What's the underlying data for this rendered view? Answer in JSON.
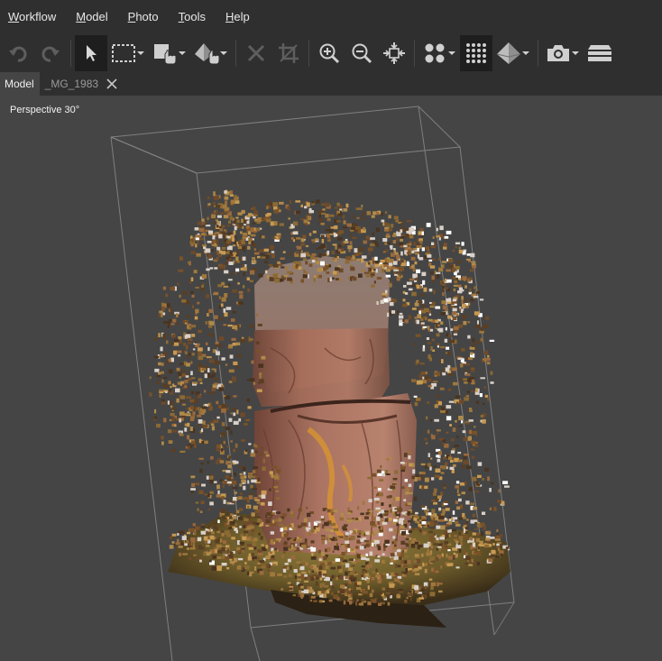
{
  "menu": [
    {
      "id": "workflow",
      "label": "Workflow",
      "mnemonic": "W",
      "rest": "orkflow"
    },
    {
      "id": "model",
      "label": "Model",
      "mnemonic": "M",
      "rest": "odel"
    },
    {
      "id": "photo",
      "label": "Photo",
      "mnemonic": "P",
      "rest": "hoto"
    },
    {
      "id": "tools",
      "label": "Tools",
      "mnemonic": "T",
      "rest": "ools"
    },
    {
      "id": "help",
      "label": "Help",
      "mnemonic": "H",
      "rest": "elp"
    }
  ],
  "toolbar": {
    "icons": [
      "undo-icon",
      "redo-icon",
      "navigation-arrow-icon",
      "rectangle-selection-icon",
      "move-region-icon",
      "rotate-object-icon",
      "delete-icon",
      "crop-icon",
      "zoom-in-icon",
      "zoom-out-icon",
      "reset-view-icon",
      "show-points-icon",
      "show-dense-cloud-icon",
      "show-model-icon",
      "show-cameras-icon",
      "show-layers-icon"
    ]
  },
  "tabs": [
    {
      "label": "Model",
      "active": true
    },
    {
      "label": "_MG_1983",
      "active": false
    }
  ],
  "viewport": {
    "projection_label": "Perspective 30°"
  },
  "colors": {
    "background": "#454545",
    "chrome": "#2f2f2f",
    "bounding_box": "#8a8a8a"
  }
}
